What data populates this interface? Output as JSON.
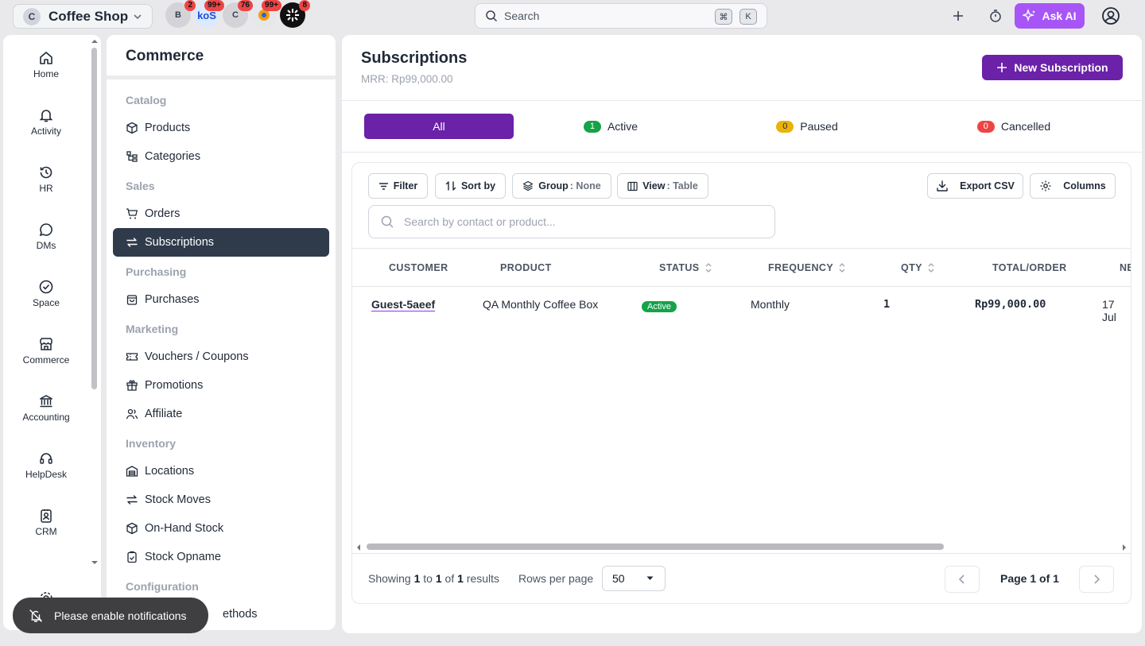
{
  "topbar": {
    "workspace_initial": "C",
    "workspace_name": "Coffee Shop",
    "apps": [
      {
        "label": "B",
        "count": "2",
        "color": "#d4d4d8"
      },
      {
        "label": "koS",
        "count": "99+",
        "color": "#93c5fd"
      },
      {
        "label": "C",
        "count": "76",
        "color": "#d4d4d8"
      },
      {
        "label": "",
        "count": "99+",
        "color": "#e5e7eb"
      },
      {
        "label": "",
        "count": "8",
        "color": "#111111"
      }
    ],
    "search_label": "Search",
    "kbd_cmd": "⌘",
    "kbd_k": "K",
    "ask_ai_label": "Ask AI"
  },
  "rail": {
    "items": [
      {
        "label": "Home",
        "icon": "home-icon"
      },
      {
        "label": "Activity",
        "icon": "bell-icon"
      },
      {
        "label": "HR",
        "icon": "history-icon"
      },
      {
        "label": "DMs",
        "icon": "chat-icon"
      },
      {
        "label": "Space",
        "icon": "check-circle-icon"
      },
      {
        "label": "Commerce",
        "icon": "store-icon"
      },
      {
        "label": "Accounting",
        "icon": "bank-icon"
      },
      {
        "label": "HelpDesk",
        "icon": "headset-icon"
      },
      {
        "label": "CRM",
        "icon": "contact-card-icon"
      }
    ]
  },
  "sidebar": {
    "title": "Commerce",
    "sections": {
      "catalog": "Catalog",
      "sales": "Sales",
      "purchasing": "Purchasing",
      "marketing": "Marketing",
      "inventory": "Inventory",
      "configuration": "Configuration"
    },
    "items": {
      "products": "Products",
      "categories": "Categories",
      "orders": "Orders",
      "subscriptions": "Subscriptions",
      "purchases": "Purchases",
      "vouchers": "Vouchers / Coupons",
      "promotions": "Promotions",
      "affiliate": "Affiliate",
      "locations": "Locations",
      "stock_moves": "Stock Moves",
      "on_hand": "On-Hand Stock",
      "opname": "Stock Opname",
      "methods": "ethods"
    }
  },
  "main": {
    "title": "Subscriptions",
    "mrr": "MRR: Rp99,000.00",
    "new_button": "New Subscription",
    "tabs": {
      "all": "All",
      "active_label": "Active",
      "active_count": "1",
      "paused_label": "Paused",
      "paused_count": "0",
      "cancelled_label": "Cancelled",
      "cancelled_count": "0"
    },
    "toolbar": {
      "filter": "Filter",
      "sort": "Sort by",
      "group": "Group",
      "group_value": ": None",
      "view": "View",
      "view_value": ": Table",
      "export": "Export CSV",
      "columns": "Columns",
      "search_placeholder": "Search by contact or product..."
    },
    "table": {
      "headers": {
        "customer": "CUSTOMER",
        "product": "PRODUCT",
        "status": "STATUS",
        "frequency": "FREQUENCY",
        "qty": "QTY",
        "total": "TOTAL/ORDER",
        "next": "NE"
      },
      "rows": [
        {
          "customer": "Guest-5aeef",
          "product": "QA Monthly Coffee Box",
          "status": "Active",
          "frequency": "Monthly",
          "qty": "1",
          "total": "Rp99,000.00",
          "next": "17 Jul"
        }
      ]
    },
    "footer": {
      "showing_prefix": "Showing",
      "from": "1",
      "to_word": "to",
      "to": "1",
      "of_word": "of",
      "total": "1",
      "results": "results",
      "rows_per_page_label": "Rows per page",
      "rows_per_page": "50",
      "page_label": "Page 1 of 1"
    }
  },
  "toast": {
    "message": "Please enable notifications"
  },
  "colors": {
    "accent": "#6b21a8",
    "ai": "#a855f7",
    "active": "#15a34a",
    "paused": "#eab308",
    "cancelled": "#ef4444",
    "sidebar_active": "#2f3a4b"
  }
}
